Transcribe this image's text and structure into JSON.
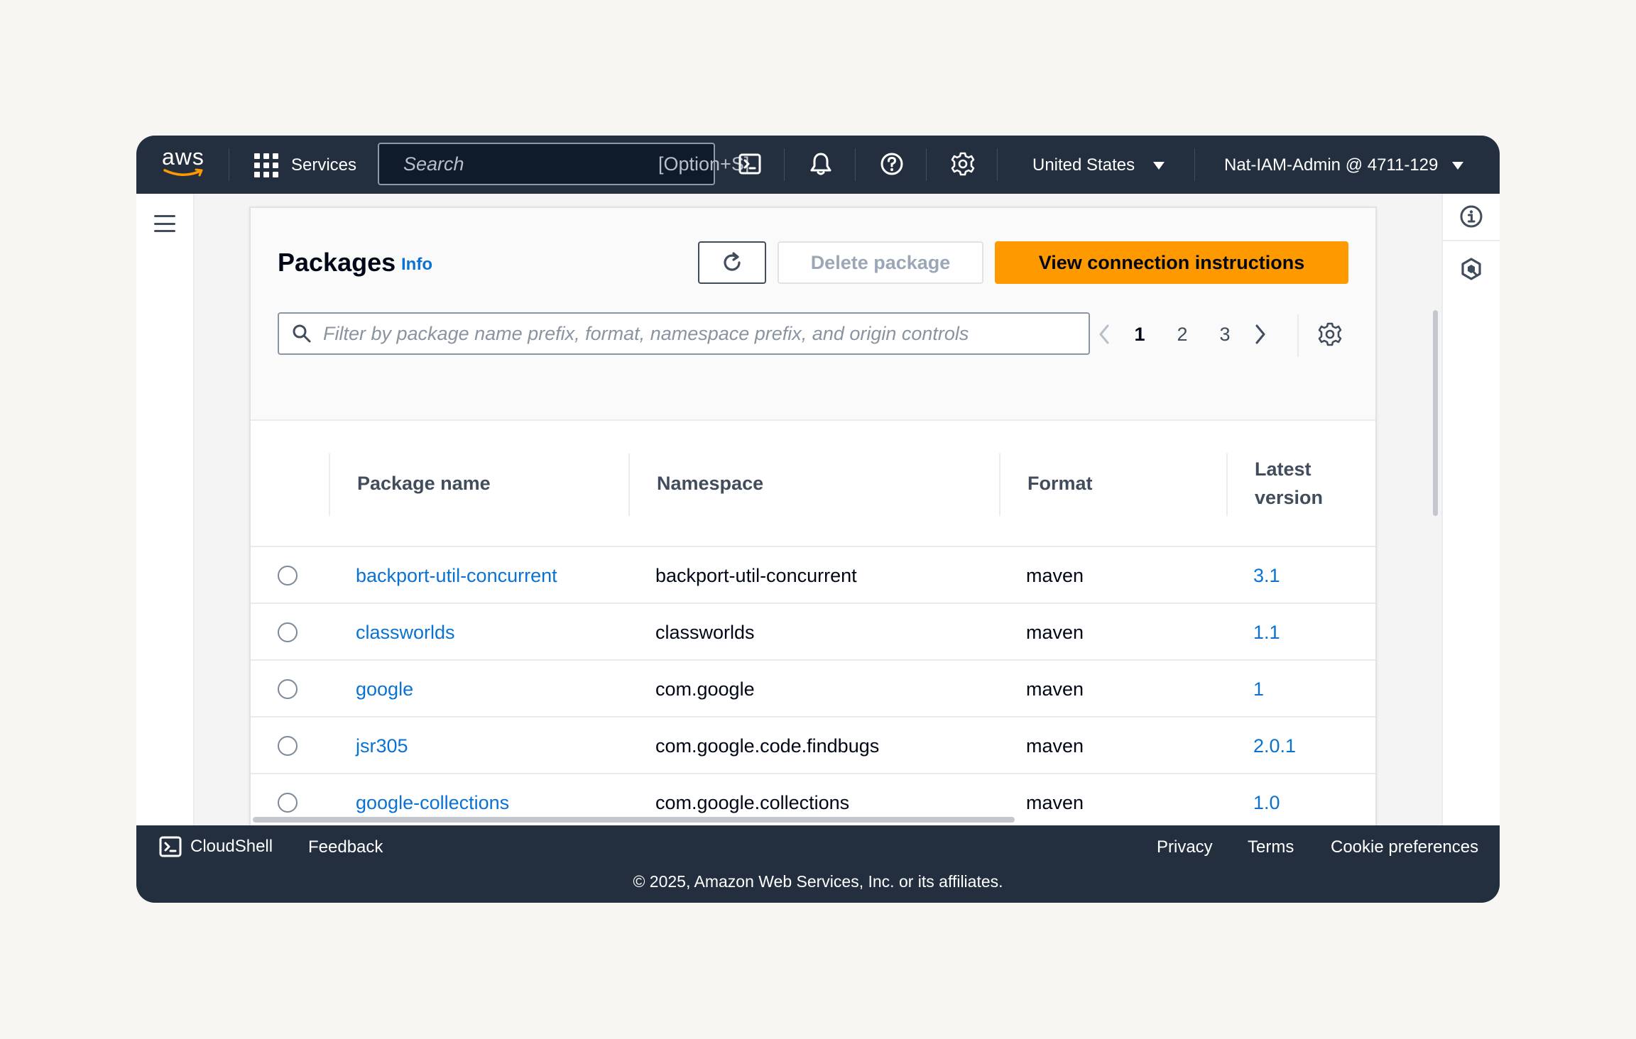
{
  "topnav": {
    "logo_text": "aws",
    "services_label": "Services",
    "search_placeholder": "Search",
    "search_shortcut": "[Option+S]",
    "region_label": "United States",
    "account_label": "Nat-IAM-Admin @ 4711-129"
  },
  "page": {
    "title": "Packages",
    "info_label": "Info",
    "delete_label": "Delete package",
    "primary_label": "View connection instructions",
    "filter_placeholder": "Filter by package name prefix, format, namespace prefix, and origin controls",
    "pages": [
      "1",
      "2",
      "3"
    ],
    "current_page": "1"
  },
  "table": {
    "columns": [
      "Package name",
      "Namespace",
      "Format",
      "Latest version"
    ],
    "rows": [
      {
        "name": "backport-util-concurrent",
        "namespace": "backport-util-concurrent",
        "format": "maven",
        "version": "3.1"
      },
      {
        "name": "classworlds",
        "namespace": "classworlds",
        "format": "maven",
        "version": "1.1"
      },
      {
        "name": "google",
        "namespace": "com.google",
        "format": "maven",
        "version": "1"
      },
      {
        "name": "jsr305",
        "namespace": "com.google.code.findbugs",
        "format": "maven",
        "version": "2.0.1"
      },
      {
        "name": "google-collections",
        "namespace": "com.google.collections",
        "format": "maven",
        "version": "1.0"
      }
    ]
  },
  "footer": {
    "cloudshell_label": "CloudShell",
    "feedback_label": "Feedback",
    "privacy_label": "Privacy",
    "terms_label": "Terms",
    "cookie_label": "Cookie preferences",
    "copyright": "© 2025, Amazon Web Services, Inc. or its affiliates."
  },
  "colors": {
    "nav_bg": "#232f3e",
    "primary": "#ff9900",
    "link": "#0972d3"
  }
}
